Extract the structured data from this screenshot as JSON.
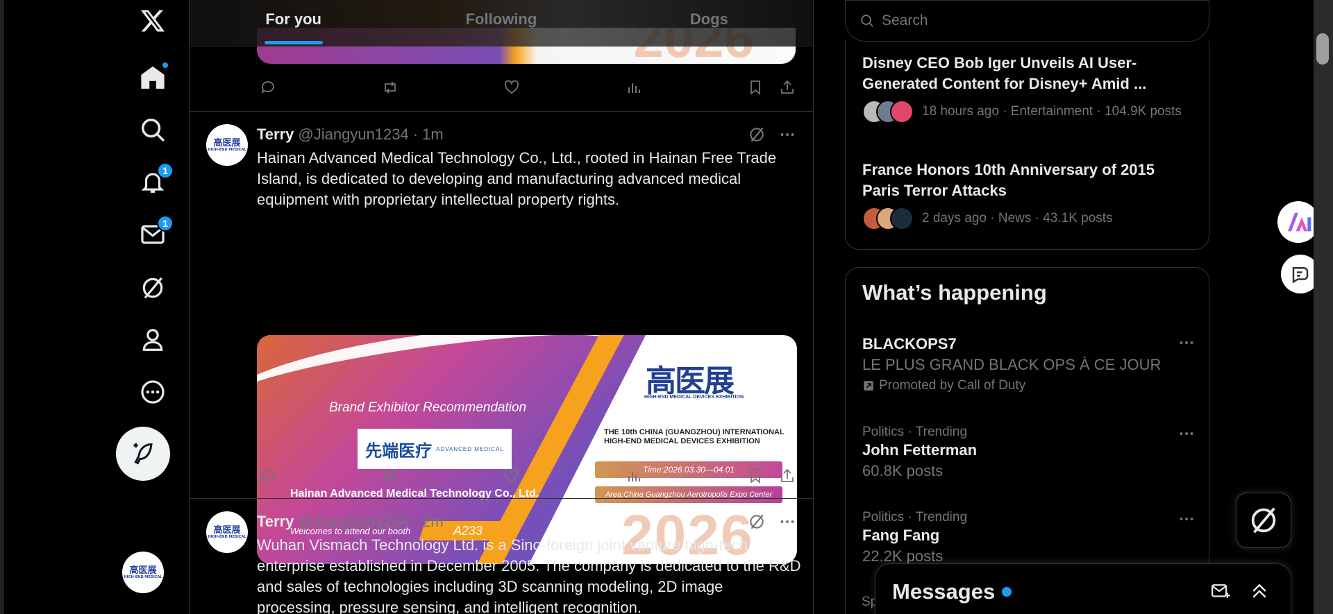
{
  "app": {
    "logo_icon": "x-logo-icon",
    "accent": "#1d9bf0"
  },
  "nav": {
    "items": [
      {
        "name": "home",
        "icon": "home-icon",
        "has_dot": true
      },
      {
        "name": "explore",
        "icon": "search-icon"
      },
      {
        "name": "notifications",
        "icon": "bell-icon",
        "badge": "1"
      },
      {
        "name": "messages",
        "icon": "mail-icon",
        "badge": "1"
      },
      {
        "name": "grok",
        "icon": "grok-icon"
      },
      {
        "name": "profile",
        "icon": "person-icon"
      },
      {
        "name": "more",
        "icon": "more-circle-icon"
      }
    ],
    "post_icon": "feather-plus-icon"
  },
  "tabs": [
    {
      "label": "For you",
      "active": true
    },
    {
      "label": "Following",
      "active": false
    },
    {
      "label": "Dogs",
      "active": false
    }
  ],
  "tweets": [
    {
      "name": "Terry",
      "handle": "@Jiangyun1234",
      "separator": "·",
      "time": "1m",
      "text": "Hainan Advanced Medical Technology Co., Ltd., rooted in Hainan Free Trade Island, is dedicated to developing and manufacturing advanced medical equipment with proprietary intellectual property rights.",
      "card": {
        "heading": "Brand Exhibitor Recommendation",
        "logo_cn": "先端医疗",
        "logo_en": "ADVANCED MEDICAL",
        "company": "Hainan Advanced Medical Technology Co., Ltd.",
        "welcome": "Welcomes to attend our booth",
        "booth": "A233",
        "expo_logo": "高医展",
        "expo_logo_sub": "HIGH-END MEDICAL DEVICES EXHIBITION",
        "expo_title": "THE 10th CHINA (GUANGZHOU) INTERNATIONAL HIGH-END MEDICAL DEVICES EXHIBITION",
        "time": "Time:2026.03.30—04.01",
        "area": "Area:China Guangzhou Aerotropolis Expo Center",
        "year": "2026"
      }
    },
    {
      "name": "Terry",
      "handle": "@Jiangyun1234",
      "separator": "·",
      "time": "2m",
      "text": "Wuhan Vismach Technology Ltd. is a Sino-foreign joint venture high-tech enterprise established in December 2005. The company is dedicated to the R&D and sales of technologies including 3D scanning modeling, 2D image processing, pressure sensing, and intelligent recognition."
    }
  ],
  "avatar_text": "高医展",
  "avatar_sub": "HIGH-END MEDICAL",
  "partial_card_year": "2026",
  "search": {
    "placeholder": "Search"
  },
  "news": [
    {
      "title": "Disney CEO Bob Iger Unveils AI User-Generated Content for Disney+ Amid ...",
      "meta": "18 hours ago · Entertainment · 104.9K posts"
    },
    {
      "title": "France Honors 10th Anniversary of 2015 Paris Terror Attacks",
      "meta": "2 days ago · News · 43.1K posts"
    }
  ],
  "happening": {
    "title": "What’s happening",
    "trends": [
      {
        "name": "BLACKOPS7",
        "sub": "LE PLUS GRAND BLACK OPS À CE JOUR",
        "promo": "Promoted by Call of Duty"
      },
      {
        "meta": "Politics · Trending",
        "name": "John Fetterman",
        "sub": "60.8K posts"
      },
      {
        "meta": "Politics · Trending",
        "name": "Fang Fang",
        "sub": "22.2K posts"
      }
    ],
    "peek": "Sp"
  },
  "messages": {
    "title": "Messages",
    "icons": [
      "new-message-icon",
      "chevron-double-up-icon"
    ]
  }
}
